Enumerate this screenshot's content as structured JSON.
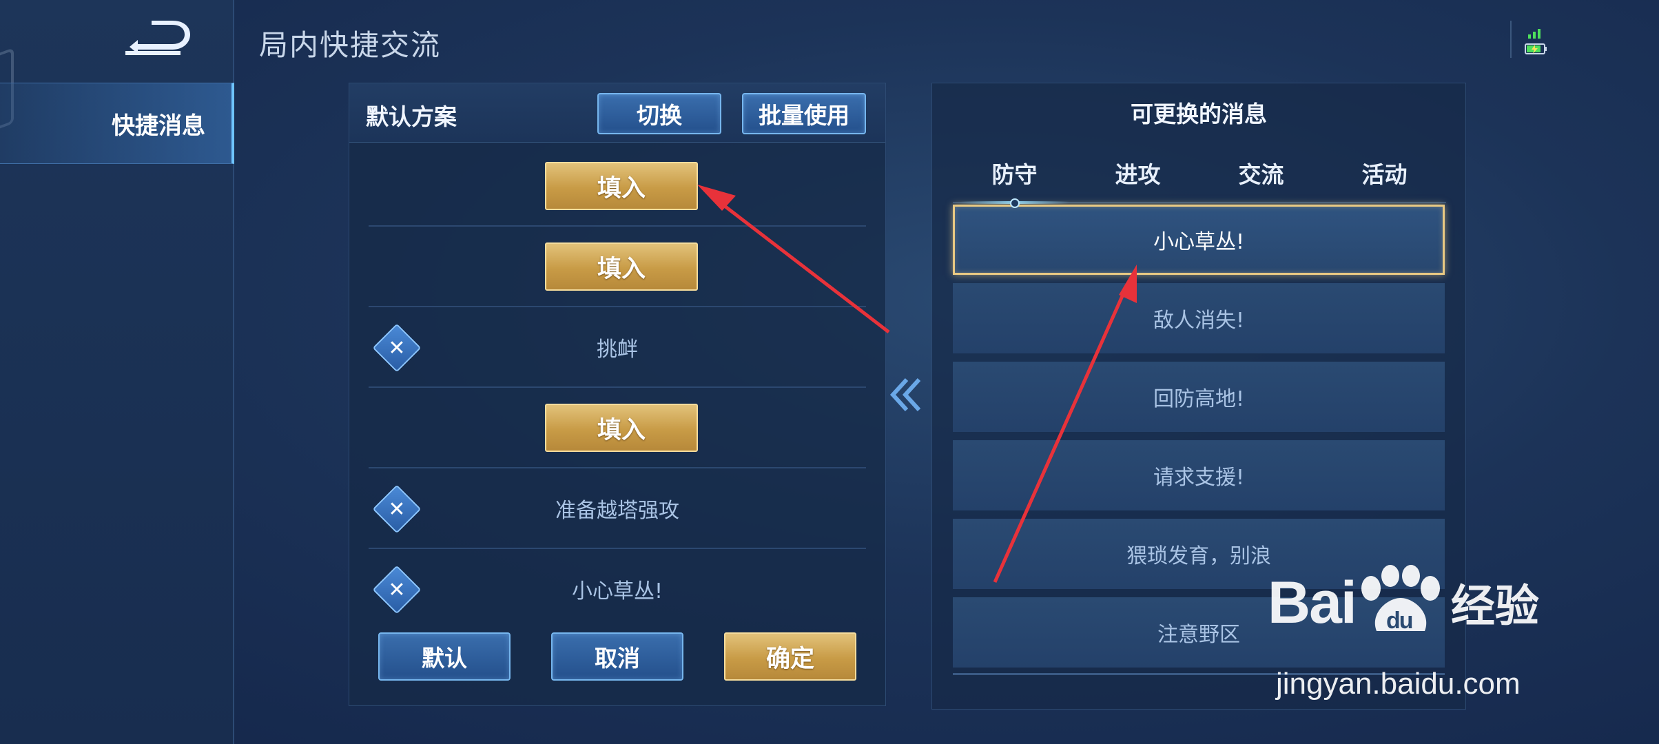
{
  "header": {
    "title": "局内快捷交流"
  },
  "sidebar": {
    "items": [
      {
        "label": "快捷消息",
        "active": true
      }
    ]
  },
  "left_panel": {
    "scheme_title": "默认方案",
    "switch_label": "切换",
    "batch_label": "批量使用",
    "slots": [
      {
        "type": "empty",
        "fill_label": "填入"
      },
      {
        "type": "empty",
        "fill_label": "填入"
      },
      {
        "type": "message",
        "text": "挑衅"
      },
      {
        "type": "empty",
        "fill_label": "填入"
      },
      {
        "type": "message",
        "text": "准备越塔强攻"
      },
      {
        "type": "message",
        "text": "小心草丛!"
      }
    ],
    "default_label": "默认",
    "cancel_label": "取消",
    "confirm_label": "确定"
  },
  "right_panel": {
    "title": "可更换的消息",
    "tabs": [
      {
        "label": "防守",
        "active": true
      },
      {
        "label": "进攻",
        "active": false
      },
      {
        "label": "交流",
        "active": false
      },
      {
        "label": "活动",
        "active": false
      }
    ],
    "messages": [
      {
        "text": "小心草丛!",
        "selected": true
      },
      {
        "text": "敌人消失!",
        "selected": false
      },
      {
        "text": "回防高地!",
        "selected": false
      },
      {
        "text": "请求支援!",
        "selected": false
      },
      {
        "text": "猥琐发育，别浪",
        "selected": false
      },
      {
        "text": "注意野区",
        "selected": false
      }
    ]
  },
  "watermark": {
    "brand_left": "Bai",
    "brand_paw": "du",
    "brand_cn": "经验",
    "url": "jingyan.baidu.com"
  },
  "colors": {
    "accent_gold": "#c89b46",
    "accent_blue": "#24508c",
    "annotation_red": "#e8323a"
  },
  "icons": {
    "back": "back-arrow-icon",
    "delete": "close-icon",
    "transfer": "double-chevron-left-icon",
    "signal": "signal-icon",
    "battery": "battery-charging-icon"
  }
}
